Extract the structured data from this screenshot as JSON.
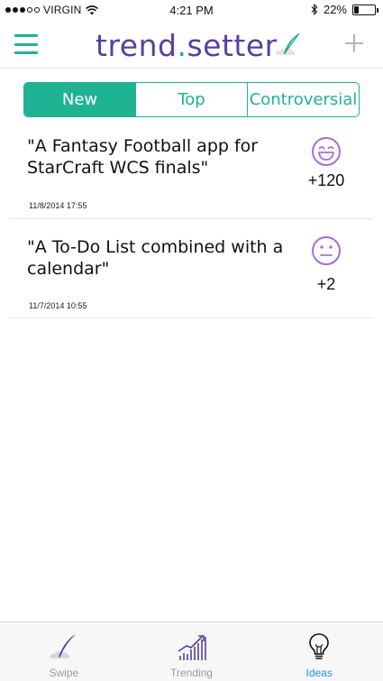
{
  "status_bar": {
    "carrier": "VIRGIN",
    "time": "4:21 PM",
    "battery": "22%",
    "battery_level": 0.22
  },
  "nav": {
    "logo_prefix": "trend",
    "logo_dot": ".",
    "logo_suffix": "setter",
    "menu_icon": "hamburger-icon",
    "add_icon": "plus-icon"
  },
  "segments": [
    {
      "label": "New",
      "active": true
    },
    {
      "label": "Top",
      "active": false
    },
    {
      "label": "Controversial",
      "active": false
    }
  ],
  "ideas": [
    {
      "text": "\"A Fantasy Football app for StarCraft WCS finals\"",
      "date": "11/8/2014 17:55",
      "score": "+120",
      "icon": "grin-face-icon"
    },
    {
      "text": "\"A To-Do List combined with a calendar\"",
      "date": "11/7/2014 10:55",
      "score": "+2",
      "icon": "neutral-face-icon"
    }
  ],
  "tabs": [
    {
      "label": "Swipe",
      "icon": "feather-cloud-icon",
      "active": false
    },
    {
      "label": "Trending",
      "icon": "trending-chart-icon",
      "active": false
    },
    {
      "label": "Ideas",
      "icon": "lightbulb-icon",
      "active": true
    }
  ],
  "colors": {
    "accent": "#1fb394",
    "brand_purple": "#5a3fa0",
    "icon_purple": "#a56ed8",
    "active_tab": "#2b8fd6"
  }
}
